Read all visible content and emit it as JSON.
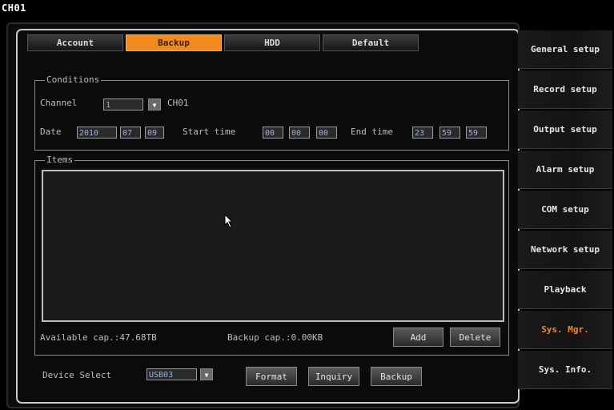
{
  "window": {
    "channel_label": "CH01"
  },
  "tabs": [
    {
      "label": "Account"
    },
    {
      "label": "Backup",
      "active": true
    },
    {
      "label": "HDD"
    },
    {
      "label": "Default"
    }
  ],
  "conditions": {
    "title": "Conditions",
    "channel_label": "Channel",
    "channel_value": "1",
    "channel_name": "CH01",
    "date_label": "Date",
    "date_year": "2010",
    "date_month": "07",
    "date_day": "09",
    "start_label": "Start time",
    "start_h": "00",
    "start_m": "00",
    "start_s": "00",
    "end_label": "End time",
    "end_h": "23",
    "end_m": "59",
    "end_s": "59"
  },
  "items": {
    "title": "Items",
    "available_cap": "Available cap.:47.68TB",
    "backup_cap": "Backup cap.:0.00KB",
    "add_label": "Add",
    "delete_label": "Delete"
  },
  "device": {
    "label": "Device Select",
    "value": "USB03",
    "format_label": "Format",
    "inquiry_label": "Inquiry",
    "backup_label": "Backup"
  },
  "sidebar": {
    "items": [
      {
        "label": "General setup"
      },
      {
        "label": "Record setup"
      },
      {
        "label": "Output setup"
      },
      {
        "label": "Alarm setup"
      },
      {
        "label": "COM setup"
      },
      {
        "label": "Network setup"
      },
      {
        "label": "Playback"
      },
      {
        "label": "Sys. Mgr.",
        "active": true
      },
      {
        "label": "Sys. Info."
      }
    ]
  },
  "colors": {
    "accent": "#f08a1c",
    "background": "#000000",
    "text": "#d9d9d9"
  },
  "icons": {
    "dropdown": "triangle-down",
    "cursor": "arrow-pointer"
  }
}
